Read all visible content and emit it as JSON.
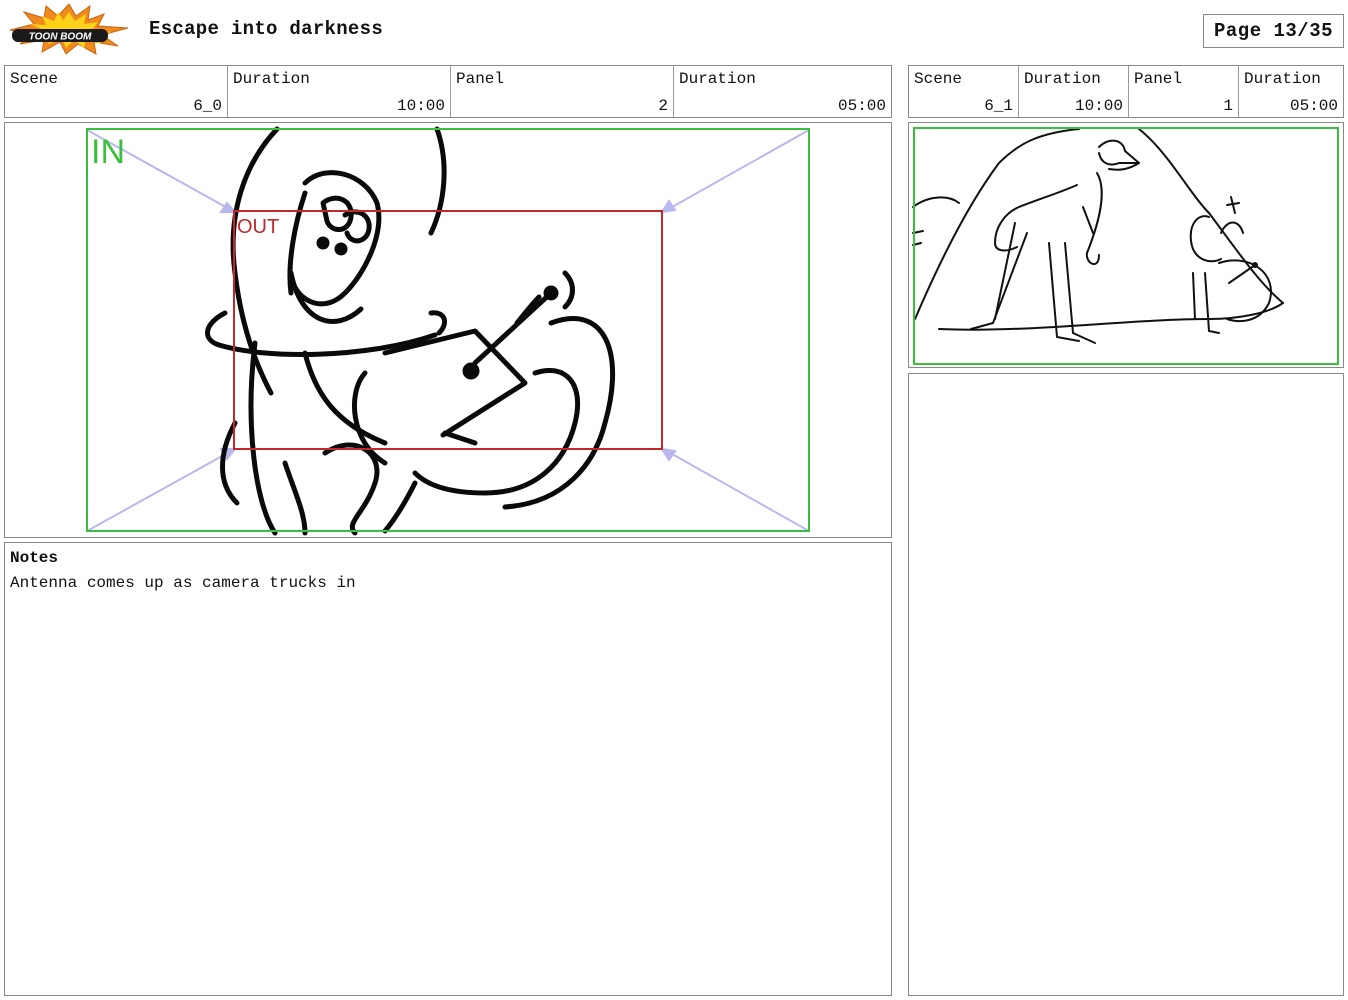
{
  "header": {
    "logo_text": "TOON BOOM",
    "title": "Escape into darkness",
    "page_label": "Page 13/35"
  },
  "left_panel": {
    "info": [
      {
        "label": "Scene",
        "value": "6_0"
      },
      {
        "label": "Duration",
        "value": "10:00"
      },
      {
        "label": "Panel",
        "value": "2"
      },
      {
        "label": "Duration",
        "value": "05:00"
      }
    ],
    "frame": {
      "in_label": "IN",
      "out_label": "OUT"
    },
    "notes": {
      "label": "Notes",
      "text": "Antenna comes up as camera trucks in"
    }
  },
  "right_panel": {
    "info": [
      {
        "label": "Scene",
        "value": "6_1"
      },
      {
        "label": "Duration",
        "value": "10:00"
      },
      {
        "label": "Panel",
        "value": "1"
      },
      {
        "label": "Duration",
        "value": "05:00"
      }
    ]
  },
  "colors": {
    "in_frame": "#3cbf3c",
    "out_frame": "#c0282c",
    "camera_arrow": "#b8b8ee",
    "logo_orange": "#f08a1c",
    "logo_yellow": "#ffd21a"
  }
}
